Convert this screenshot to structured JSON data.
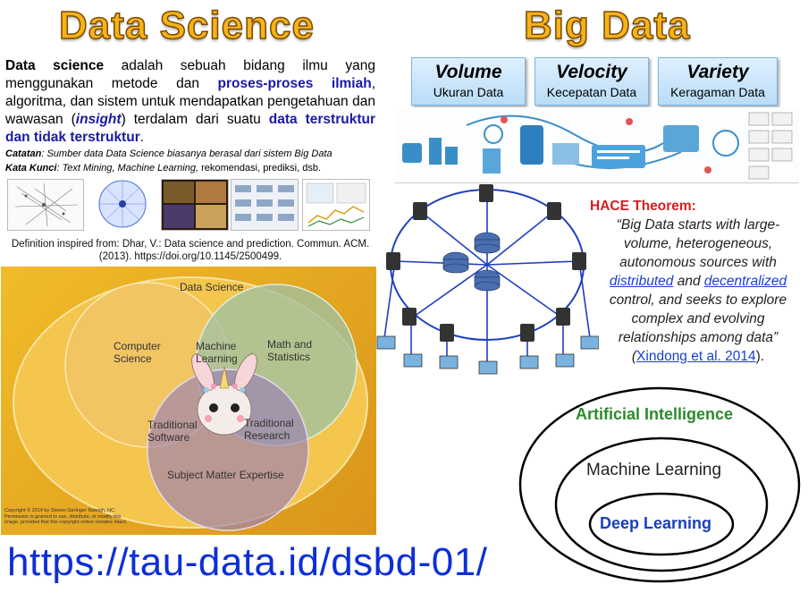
{
  "left_title": "Data Science",
  "right_title": "Big Data",
  "definition": {
    "p1": "Data science",
    "p2": " adalah sebuah bidang ilmu yang menggunakan metode dan ",
    "p3": "proses-proses ilmiah",
    "p4": ", algoritma, dan sistem untuk mendapatkan pengetahuan dan wawasan (",
    "p5": "insight",
    "p6": ") terdalam dari suatu ",
    "p7": "data terstruktur dan tidak terstruktur",
    "p8": "."
  },
  "note": {
    "catatan_label": "Catatan",
    "catatan_text": ": Sumber data Data Science biasanya berasal dari sistem Big Data",
    "kata_label": "Kata Kunci",
    "kata_text_italic": ": Text Mining, Machine Learning,",
    "kata_text_rest": " rekomendasi, prediksi, dsb."
  },
  "citation": "Definition inspired from: Dhar, V.: Data science and prediction. Commun. ACM. (2013). https://doi.org/10.1145/2500499.",
  "venn": {
    "outer": "Data Science",
    "cs": "Computer Science",
    "ml": "Machine Learning",
    "math": "Math and Statistics",
    "trad_sw": "Traditional Software",
    "trad_res": "Traditional Research",
    "sme": "Subject Matter Expertise",
    "copyright": "Copyright © 2014 by Steven Geringer Raleigh, NC. Permission is granted to use, distribute, or modify this image, provided that this copyright notice remains intact."
  },
  "v3": [
    {
      "title": "Volume",
      "sub": "Ukuran Data"
    },
    {
      "title": "Velocity",
      "sub": "Kecepatan Data"
    },
    {
      "title": "Variety",
      "sub": "Keragaman Data"
    }
  ],
  "hace": {
    "title": "HACE Theorem:",
    "q1": "“Big Data starts with large-volume, heterogeneous, autonomous sources with ",
    "distributed": "distributed",
    "and": " and ",
    "decentralized": "decentralized",
    "q2": " control, and seeks to explore complex and evolving relationships among data” (",
    "xindong": "Xindong et al. 2014",
    "q3": ")."
  },
  "ai": {
    "ai": "Artificial Intelligence",
    "ml": "Machine Learning",
    "dl": "Deep Learning"
  },
  "url": "https://tau-data.id/dsbd-01/",
  "colors": {
    "title_fill": "#f6b21b",
    "blue_text": "#1a1aa8",
    "url_blue": "#0d2fd6",
    "ai_green": "#2d8a2d",
    "dl_blue": "#1a3fb8",
    "venn_bg": "#e8a91c"
  }
}
